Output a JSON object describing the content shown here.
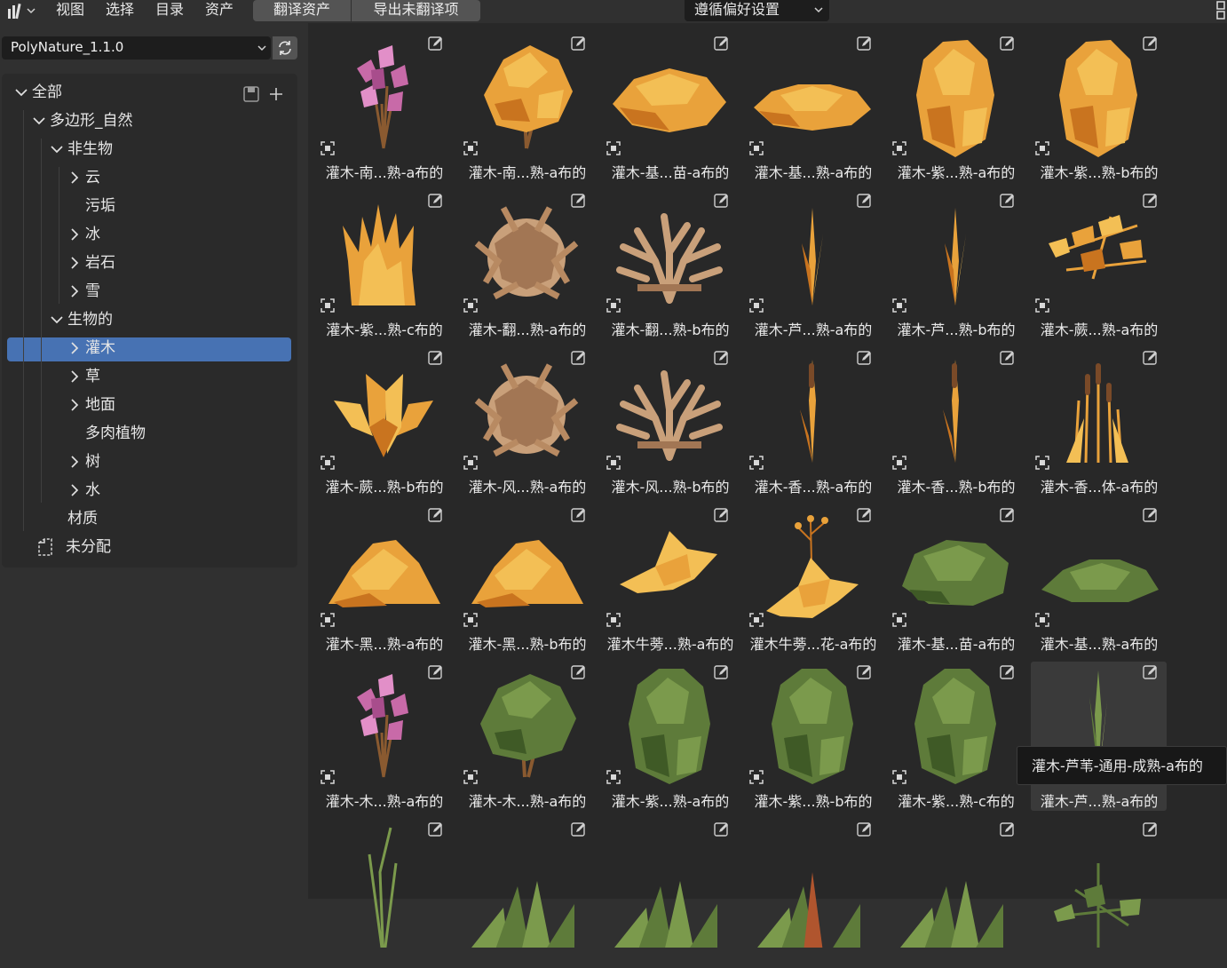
{
  "header": {
    "menus": [
      "视图",
      "选择",
      "目录",
      "资产"
    ],
    "translate_assets": "翻译资产",
    "export_untranslated": "导出未翻译项",
    "preference_select": "遵循偏好设置"
  },
  "sidebar": {
    "library": "PolyNature_1.1.0",
    "tree": [
      {
        "label": "全部",
        "level": 0,
        "expanded": true
      },
      {
        "label": "多边形_自然",
        "level": 1,
        "expanded": true
      },
      {
        "label": "非生物",
        "level": 2,
        "expanded": true
      },
      {
        "label": "云",
        "level": 3,
        "expanded": false
      },
      {
        "label": "污垢",
        "level": 3,
        "expanded": null
      },
      {
        "label": "冰",
        "level": 3,
        "expanded": false
      },
      {
        "label": "岩石",
        "level": 3,
        "expanded": false
      },
      {
        "label": "雪",
        "level": 3,
        "expanded": false
      },
      {
        "label": "生物的",
        "level": 2,
        "expanded": true
      },
      {
        "label": "灌木",
        "level": 3,
        "expanded": false,
        "selected": true
      },
      {
        "label": "草",
        "level": 3,
        "expanded": false
      },
      {
        "label": "地面",
        "level": 3,
        "expanded": false
      },
      {
        "label": "多肉植物",
        "level": 3,
        "expanded": null
      },
      {
        "label": "树",
        "level": 3,
        "expanded": false
      },
      {
        "label": "水",
        "level": 3,
        "expanded": false
      },
      {
        "label": "材质",
        "level": 2,
        "expanded": null
      },
      {
        "label": "未分配",
        "level": 1,
        "expanded": null,
        "icon": "unassigned-icon"
      }
    ]
  },
  "assets": [
    {
      "label": "灌木-南...熟-a布的",
      "kind": "pink"
    },
    {
      "label": "灌木-南...熟-a布的",
      "kind": "orange-bush"
    },
    {
      "label": "灌木-基...苗-a布的",
      "kind": "flat-mound"
    },
    {
      "label": "灌木-基...熟-a布的",
      "kind": "low-mound"
    },
    {
      "label": "灌木-紫...熟-a布的",
      "kind": "tall-bush"
    },
    {
      "label": "灌木-紫...熟-b布的",
      "kind": "tall-bush"
    },
    {
      "label": "灌木-紫...熟-c布的",
      "kind": "grass-clump"
    },
    {
      "label": "灌木-翻...熟-a布的",
      "kind": "tumbleweed"
    },
    {
      "label": "灌木-翻...熟-b布的",
      "kind": "branches"
    },
    {
      "label": "灌木-芦...熟-a布的",
      "kind": "reed"
    },
    {
      "label": "灌木-芦...熟-b布的",
      "kind": "reed"
    },
    {
      "label": "灌木-蕨...熟-a布的",
      "kind": "fern"
    },
    {
      "label": "灌木-蕨...熟-b布的",
      "kind": "fern-small"
    },
    {
      "label": "灌木-风...熟-a布的",
      "kind": "tumbleweed"
    },
    {
      "label": "灌木-风...熟-b布的",
      "kind": "branches"
    },
    {
      "label": "灌木-香...熟-a布的",
      "kind": "cattail"
    },
    {
      "label": "灌木-香...熟-b布的",
      "kind": "cattail"
    },
    {
      "label": "灌木-香...体-a布的",
      "kind": "cattails"
    },
    {
      "label": "灌木-黑...熟-a布的",
      "kind": "pile"
    },
    {
      "label": "灌木-黑...熟-b布的",
      "kind": "pile"
    },
    {
      "label": "灌木牛蒡...熟-a布的",
      "kind": "burdock"
    },
    {
      "label": "灌木牛蒡...花-a布的",
      "kind": "burdock-flower"
    },
    {
      "label": "灌木-基...苗-a布的",
      "kind": "green-mound"
    },
    {
      "label": "灌木-基...熟-a布的",
      "kind": "green-low"
    },
    {
      "label": "灌木-木...熟-a布的",
      "kind": "pink"
    },
    {
      "label": "灌木-木...熟-a布的",
      "kind": "green-tree"
    },
    {
      "label": "灌木-紫...熟-a布的",
      "kind": "green-tall"
    },
    {
      "label": "灌木-紫...熟-b布的",
      "kind": "green-tall"
    },
    {
      "label": "灌木-紫...熟-c布的",
      "kind": "green-tall"
    },
    {
      "label": "灌木-芦...熟-a布的",
      "kind": "green-reed",
      "hovered": true
    },
    {
      "label": "",
      "kind": "grass-thin"
    },
    {
      "label": "",
      "kind": "agave"
    },
    {
      "label": "",
      "kind": "agave"
    },
    {
      "label": "",
      "kind": "agave-red"
    },
    {
      "label": "",
      "kind": "agave"
    },
    {
      "label": "",
      "kind": "green-fern"
    }
  ],
  "tooltip": "灌木-芦苇-通用-成熟-a布的",
  "colors": {
    "selection": "#4772b3",
    "orange": "#e9a23b",
    "pink": "#c86aa8",
    "green": "#5e7b3a",
    "brown": "#a27654"
  }
}
